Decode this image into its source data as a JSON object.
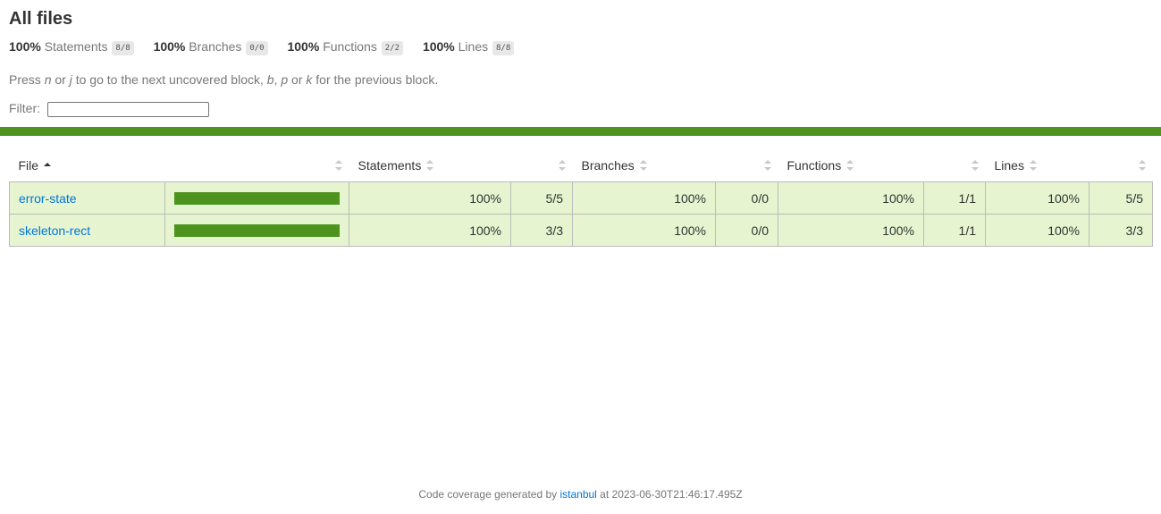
{
  "header": {
    "title": "All files"
  },
  "summary": [
    {
      "pct": "100%",
      "label": "Statements",
      "fraction": "8/8"
    },
    {
      "pct": "100%",
      "label": "Branches",
      "fraction": "0/0"
    },
    {
      "pct": "100%",
      "label": "Functions",
      "fraction": "2/2"
    },
    {
      "pct": "100%",
      "label": "Lines",
      "fraction": "8/8"
    }
  ],
  "hint": {
    "prefix": "Press ",
    "key1": "n",
    "or1": " or ",
    "key2": "j",
    "mid": " to go to the next uncovered block, ",
    "key3": "b",
    "comma": ", ",
    "key4": "p",
    "or2": " or ",
    "key5": "k",
    "suffix": " for the previous block."
  },
  "filter": {
    "label": "Filter:",
    "value": "",
    "placeholder": ""
  },
  "colors": {
    "status_bar": "#4d931d",
    "row_bg": "#e6f5d0",
    "link": "#0074d9"
  },
  "table": {
    "headers": {
      "file": "File",
      "statements": "Statements",
      "branches": "Branches",
      "functions": "Functions",
      "lines": "Lines"
    },
    "rows": [
      {
        "file": "error-state",
        "coverage": 1.0,
        "statements_pct": "100%",
        "statements_frac": "5/5",
        "branches_pct": "100%",
        "branches_frac": "0/0",
        "functions_pct": "100%",
        "functions_frac": "1/1",
        "lines_pct": "100%",
        "lines_frac": "5/5"
      },
      {
        "file": "skeleton-rect",
        "coverage": 1.0,
        "statements_pct": "100%",
        "statements_frac": "3/3",
        "branches_pct": "100%",
        "branches_frac": "0/0",
        "functions_pct": "100%",
        "functions_frac": "1/1",
        "lines_pct": "100%",
        "lines_frac": "3/3"
      }
    ]
  },
  "footer": {
    "prefix": "Code coverage generated by ",
    "link": "istanbul",
    "suffix": " at 2023-06-30T21:46:17.495Z"
  }
}
